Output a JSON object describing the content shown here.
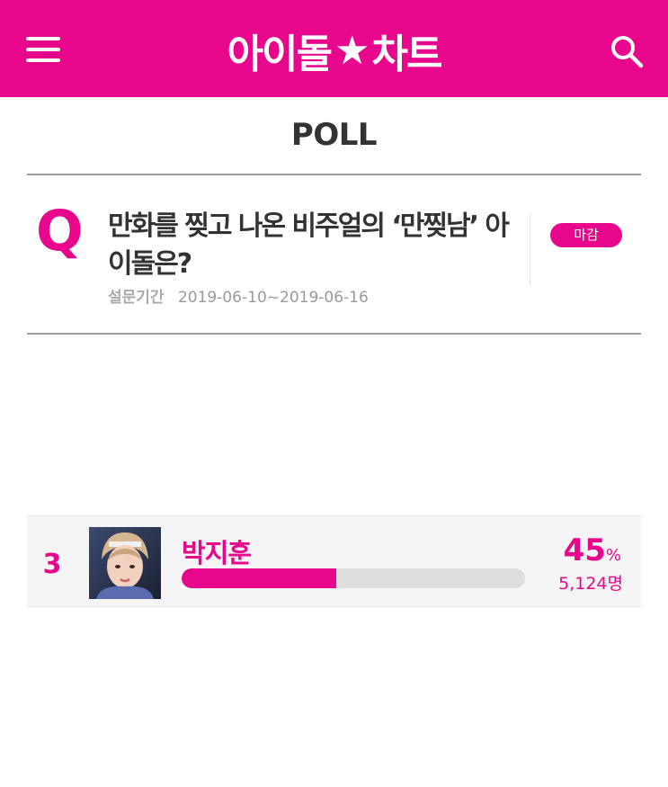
{
  "header": {
    "logo_left": "아이돌",
    "logo_star": "★",
    "logo_right": "차트",
    "menu_icon": "hamburger-menu-icon",
    "search_icon": "search-icon",
    "brand_color": "#e8078c"
  },
  "page": {
    "title": "POLL"
  },
  "poll": {
    "q_mark": "Q",
    "question": "만화를 찢고 나온 비주얼의 ‘만찢남’ 아이돌은?",
    "period_label": "설문기간",
    "period_value": "2019-06-10~2019-06-16",
    "status": "마감"
  },
  "results": [
    {
      "rank": "3",
      "name": "박지훈",
      "percent": "45",
      "percent_unit": "%",
      "percent_value": 45,
      "votes": "5,124명"
    }
  ]
}
